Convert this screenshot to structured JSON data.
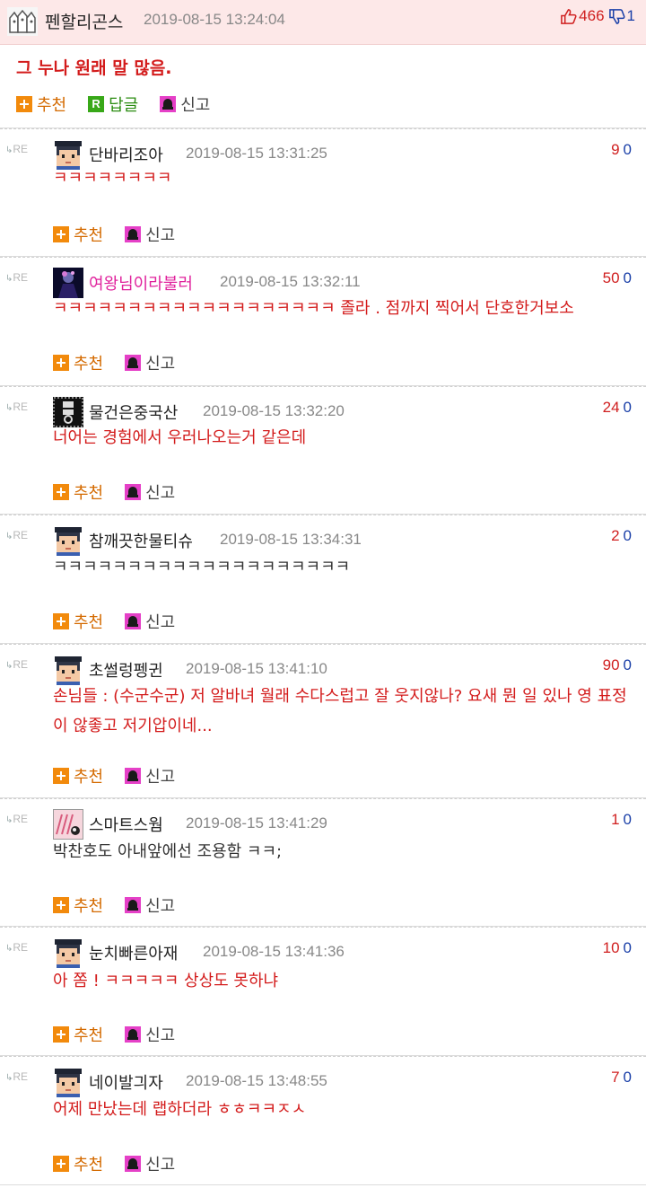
{
  "post": {
    "author": "펜할리곤스",
    "date": "2019-08-15 13:24:04",
    "up": "466",
    "down": "1",
    "text": "그 누나 원래 말 많음.",
    "actions": {
      "recommend": "추천",
      "reply": "답글",
      "report": "신고"
    }
  },
  "comments": [
    {
      "author": "단바리조아",
      "date": "2019-08-15 13:31:25",
      "up": "9",
      "down": "0",
      "text": "ㅋㅋㅋㅋㅋㅋㅋㅋ",
      "avatar": "pixel-face",
      "author_color": "#222222"
    },
    {
      "author": "여왕님이라불러",
      "date": "2019-08-15 13:32:11",
      "up": "50",
      "down": "0",
      "text": "ㅋㅋㅋㅋㅋㅋㅋㅋㅋㅋㅋㅋㅋㅋㅋㅋㅋㅋㅋ 졸라 . 점까지 찍어서 단호한거보소",
      "avatar": "dark-portrait",
      "author_color": "#e0219c"
    },
    {
      "author": "물건은중국산",
      "date": "2019-08-15 13:32:20",
      "up": "24",
      "down": "0",
      "text": "너어는 경험에서 우러나오는거 같은데",
      "avatar": "black-sign",
      "author_color": "#222222"
    },
    {
      "author": "참깨끗한물티슈",
      "date": "2019-08-15 13:34:31",
      "up": "2",
      "down": "0",
      "text": "ㅋㅋㅋㅋㅋㅋㅋㅋㅋㅋㅋㅋㅋㅋㅋㅋㅋㅋㅋㅋ",
      "avatar": "pixel-face",
      "author_color": "#222222"
    },
    {
      "author": "초썰렁펭귄",
      "date": "2019-08-15 13:41:10",
      "up": "90",
      "down": "0",
      "text": "손님들 : (수군수군) 저 알바녀 월래 수다스럽고 잘 웃지않나? 요새 뭔 일 있나 영 표정이 않좋고 저기압이네...",
      "avatar": "pixel-face",
      "author_color": "#222222"
    },
    {
      "author": "스마트스웜",
      "date": "2019-08-15 13:41:29",
      "up": "1",
      "down": "0",
      "text": "박찬호도 아내앞에선 조용함 ㅋㅋ;",
      "avatar": "pink-art",
      "author_color": "#222222"
    },
    {
      "author": "눈치빠른아재",
      "date": "2019-08-15 13:41:36",
      "up": "10",
      "down": "0",
      "text": "아 쫌 ! ㅋㅋㅋㅋㅋ 상상도 못하냐",
      "avatar": "pixel-face",
      "author_color": "#222222"
    },
    {
      "author": "네이발긔자",
      "date": "2019-08-15 13:48:55",
      "up": "7",
      "down": "0",
      "text": "어제 만났는데 랩하더라 ㅎㅎㅋㅋㅈㅅ",
      "avatar": "pixel-face",
      "author_color": "#222222"
    }
  ],
  "labels": {
    "re": "RE",
    "recommend": "추천",
    "report": "신고"
  },
  "colors": {
    "header_bg": "#fde8e8",
    "accent_red": "#d31b1b",
    "vote_blue": "#1a3fa8"
  },
  "icons": [
    "thumb-up-icon",
    "thumb-down-icon",
    "plus-icon",
    "reply-icon",
    "report-icon",
    "re-arrow-icon"
  ]
}
